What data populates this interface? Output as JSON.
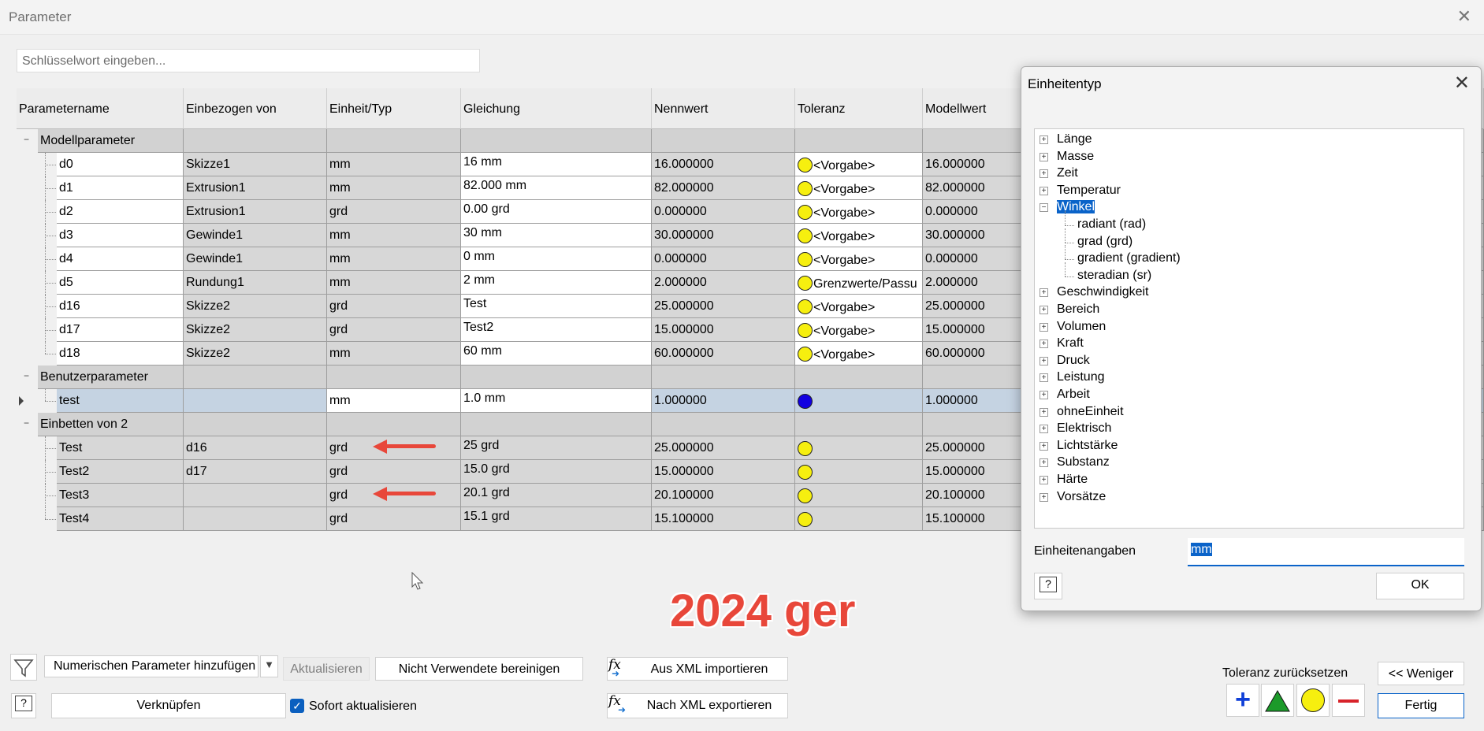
{
  "window": {
    "title": "Parameter",
    "close_glyph": "✕"
  },
  "search": {
    "placeholder": "Schlüsselwort eingeben..."
  },
  "grid": {
    "columns": [
      "Parametername",
      "Einbezogen von",
      "Einheit/Typ",
      "Gleichung",
      "Nennwert",
      "Toleranz",
      "Modellwert"
    ],
    "groups": {
      "model": "Modellparameter",
      "user": "Benutzerparameter",
      "embed": "Einbetten von 2"
    },
    "model_rows": [
      {
        "name": "d0",
        "by": "Skizze1",
        "unit": "mm",
        "eq": "16 mm",
        "nom": "16.000000",
        "tol": "<Vorgabe>",
        "model": "16.000000"
      },
      {
        "name": "d1",
        "by": "Extrusion1",
        "unit": "mm",
        "eq": "82.000 mm",
        "nom": "82.000000",
        "tol": "<Vorgabe>",
        "model": "82.000000"
      },
      {
        "name": "d2",
        "by": "Extrusion1",
        "unit": "grd",
        "eq": "0.00 grd",
        "nom": "0.000000",
        "tol": "<Vorgabe>",
        "model": "0.000000"
      },
      {
        "name": "d3",
        "by": "Gewinde1",
        "unit": "mm",
        "eq": "30 mm",
        "nom": "30.000000",
        "tol": "<Vorgabe>",
        "model": "30.000000"
      },
      {
        "name": "d4",
        "by": "Gewinde1",
        "unit": "mm",
        "eq": "0 mm",
        "nom": "0.000000",
        "tol": "<Vorgabe>",
        "model": "0.000000"
      },
      {
        "name": "d5",
        "by": "Rundung1",
        "unit": "mm",
        "eq": "2 mm",
        "nom": "2.000000",
        "tol": "Grenzwerte/Passu",
        "model": "2.000000"
      },
      {
        "name": "d16",
        "by": "Skizze2",
        "unit": "grd",
        "eq": "Test",
        "nom": "25.000000",
        "tol": "<Vorgabe>",
        "model": "25.000000"
      },
      {
        "name": "d17",
        "by": "Skizze2",
        "unit": "grd",
        "eq": "Test2",
        "nom": "15.000000",
        "tol": "<Vorgabe>",
        "model": "15.000000"
      },
      {
        "name": "d18",
        "by": "Skizze2",
        "unit": "mm",
        "eq": "60 mm",
        "nom": "60.000000",
        "tol": "<Vorgabe>",
        "model": "60.000000"
      }
    ],
    "user_rows": [
      {
        "name": "test",
        "by": "",
        "unit": "mm",
        "eq": "1.0 mm",
        "nom": "1.000000",
        "tol": "",
        "model": "1.000000"
      }
    ],
    "embed_rows": [
      {
        "name": "Test",
        "by": "d16",
        "unit": "grd",
        "eq": "25 grd",
        "nom": "25.000000",
        "tol": "",
        "model": "25.000000"
      },
      {
        "name": "Test2",
        "by": "d17",
        "unit": "grd",
        "eq": "15.0 grd",
        "nom": "15.000000",
        "tol": "",
        "model": "15.000000"
      },
      {
        "name": "Test3",
        "by": "",
        "unit": "grd",
        "eq": "20.1 grd",
        "nom": "20.100000",
        "tol": "",
        "model": "20.100000"
      },
      {
        "name": "Test4",
        "by": "",
        "unit": "grd",
        "eq": "15.1 grd",
        "nom": "15.100000",
        "tol": "",
        "model": "15.100000"
      }
    ]
  },
  "watermark": "2024 ger",
  "toolbar": {
    "add_numeric": "Numerischen Parameter hinzufügen",
    "update": "Aktualisieren",
    "purge": "Nicht Verwendete bereinigen",
    "import_xml": "Aus XML importieren",
    "link": "Verknüpfen",
    "immediate_update": "Sofort aktualisieren",
    "export_xml": "Nach XML exportieren",
    "reset_tolerance": "Toleranz zurücksetzen",
    "less": "<< Weniger",
    "done": "Fertig",
    "help": "?"
  },
  "units_dialog": {
    "title": "Einheitentyp",
    "tree": [
      {
        "label": "Länge",
        "level": 0,
        "expandable": true
      },
      {
        "label": "Masse",
        "level": 0,
        "expandable": true
      },
      {
        "label": "Zeit",
        "level": 0,
        "expandable": true
      },
      {
        "label": "Temperatur",
        "level": 0,
        "expandable": true
      },
      {
        "label": "Winkel",
        "level": 0,
        "expandable": true,
        "expanded": true,
        "selected": true
      },
      {
        "label": "radiant (rad)",
        "level": 1
      },
      {
        "label": "grad (grd)",
        "level": 1
      },
      {
        "label": "gradient (gradient)",
        "level": 1
      },
      {
        "label": "steradian (sr)",
        "level": 1
      },
      {
        "label": "Geschwindigkeit",
        "level": 0,
        "expandable": true
      },
      {
        "label": "Bereich",
        "level": 0,
        "expandable": true
      },
      {
        "label": "Volumen",
        "level": 0,
        "expandable": true
      },
      {
        "label": "Kraft",
        "level": 0,
        "expandable": true
      },
      {
        "label": "Druck",
        "level": 0,
        "expandable": true
      },
      {
        "label": "Leistung",
        "level": 0,
        "expandable": true
      },
      {
        "label": "Arbeit",
        "level": 0,
        "expandable": true
      },
      {
        "label": "ohneEinheit",
        "level": 0,
        "expandable": true
      },
      {
        "label": "Elektrisch",
        "level": 0,
        "expandable": true
      },
      {
        "label": "Lichtstärke",
        "level": 0,
        "expandable": true
      },
      {
        "label": "Substanz",
        "level": 0,
        "expandable": true
      },
      {
        "label": "Härte",
        "level": 0,
        "expandable": true
      },
      {
        "label": "Vorsätze",
        "level": 0,
        "expandable": true
      }
    ],
    "spec_label": "Einheitenangaben",
    "spec_value": "mm",
    "ok": "OK",
    "help": "?"
  },
  "colors": {
    "tolerance_default": "#f6ef0f",
    "tolerance_user": "#1200e0",
    "selection": "#0a63c9",
    "watermark": "#e8473a"
  }
}
